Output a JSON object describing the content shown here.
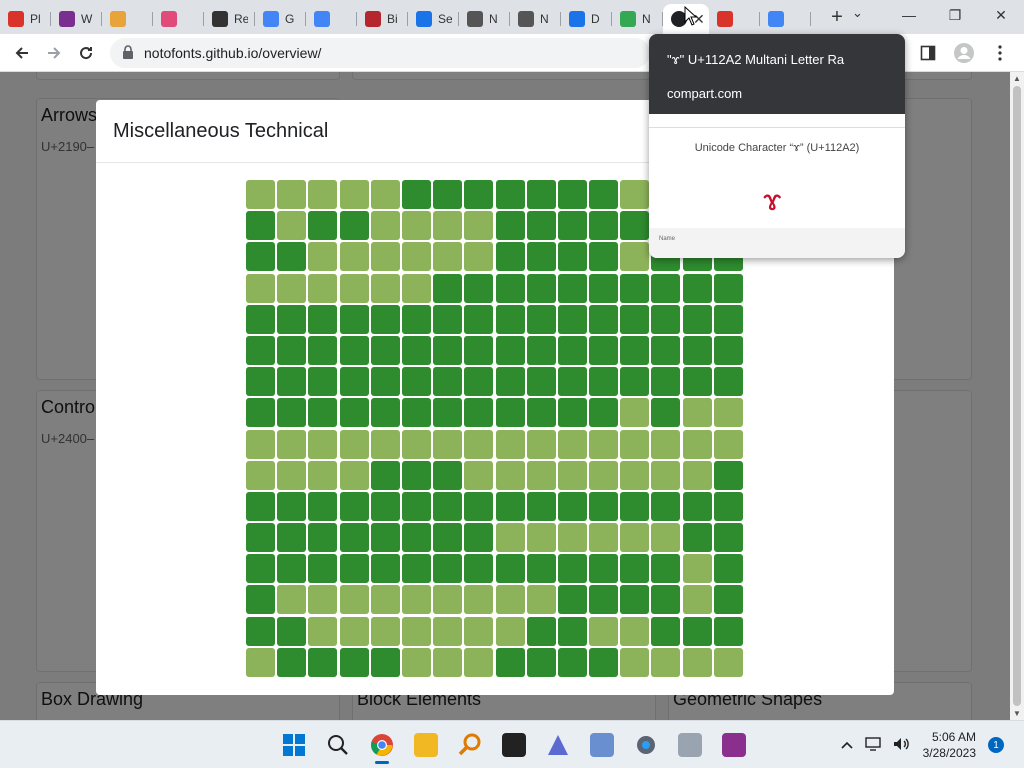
{
  "browser": {
    "tabs": [
      {
        "label": "Pl",
        "color": "#d9342b"
      },
      {
        "label": "W",
        "color": "#7a2e8f"
      },
      {
        "label": "",
        "color": "#e8a33a"
      },
      {
        "label": "",
        "color": "#e04b7a"
      },
      {
        "label": "Re",
        "color": "#333333"
      },
      {
        "label": "G",
        "color": "#4285f4"
      },
      {
        "label": "",
        "color": "#4285f4"
      },
      {
        "label": "Bi",
        "color": "#b5272d"
      },
      {
        "label": "Se",
        "color": "#1a73e8"
      },
      {
        "label": "N",
        "color": "#555555"
      },
      {
        "label": "N",
        "color": "#555555"
      },
      {
        "label": "D",
        "color": "#1a73e8"
      },
      {
        "label": "N",
        "color": "#34a853"
      }
    ],
    "active_tab": {
      "label": "",
      "close": "✕"
    },
    "after_tabs": [
      {
        "label": "",
        "color": "#d9342b"
      },
      {
        "label": "",
        "color": "#4285f4"
      }
    ],
    "new_tab": "+",
    "url": "notofonts.github.io/overview/",
    "window": {
      "minimize": "—",
      "maximize": "❐",
      "close": "✕"
    },
    "tab_search": "⌄"
  },
  "background_cards": [
    {
      "title": "Arrows",
      "sub": "U+2190–"
    },
    {
      "title": "Control",
      "sub": "U+2400–"
    },
    {
      "title": "Box Drawing",
      "sub": ""
    },
    {
      "title": "Block Elements",
      "sub": ""
    },
    {
      "title": "Geometric Shapes",
      "sub": ""
    }
  ],
  "modal": {
    "title": "Miscellaneous Technical",
    "grid_rows": [
      "llllldddddddllll",
      "dlddllllddddddll",
      "ddllllllddddlddd",
      "lllllldddddddddd",
      "dddddddddddddddd",
      "dddddddddddddddd",
      "dddddddddddddddd",
      "ddddddddddddldll",
      "llllllllllllllll",
      "lllldddlllllllld",
      "dddddddddddddddd",
      "ddddddddlllllldd",
      "ddddddddddddddld",
      "dlllllllllddddldd",
      "ddlllllllddlldddd",
      "lddddlllddddllll"
    ]
  },
  "preview": {
    "title": "\"ɤ\" U+112A2 Multani Letter Ra",
    "host": "compart.com",
    "page_title": "Unicode Character “ɤ” (U+112A2)",
    "glyph": "ɤ",
    "row_label": "Name"
  },
  "taskbar": {
    "time": "5:06 AM",
    "date": "3/28/2023",
    "notifications": "1"
  }
}
